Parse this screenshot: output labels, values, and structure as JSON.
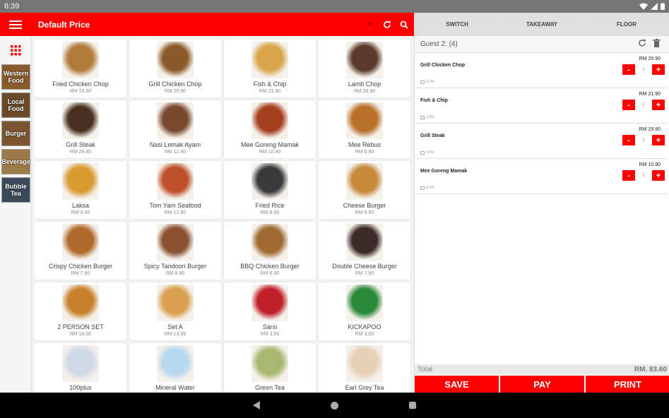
{
  "status": {
    "time": "6:39"
  },
  "toolbar": {
    "title": "Default Price"
  },
  "categories": [
    {
      "label": "Western Food",
      "color": "#8b5a2b"
    },
    {
      "label": "Local Food",
      "color": "#6b4a2a"
    },
    {
      "label": "Burger",
      "color": "#7a5530"
    },
    {
      "label": "Beverage",
      "color": "#9c7b48"
    },
    {
      "label": "Bubble Tea",
      "color": "#3a4a5a"
    }
  ],
  "products": [
    {
      "name": "Fried Chicken Chop",
      "price": "RM 19.90",
      "color": "#b07a3a"
    },
    {
      "name": "Grill Chicken Chop",
      "price": "RM 20.90",
      "color": "#8a5a2a"
    },
    {
      "name": "Fish & Chip",
      "price": "RM 21.90",
      "color": "#d9a54a"
    },
    {
      "name": "Lamb Chop",
      "price": "RM 26.90",
      "color": "#5a3a2a"
    },
    {
      "name": "Grill Steak",
      "price": "RM 29.90",
      "color": "#4a3020"
    },
    {
      "name": "Nasi Lemak Ayam",
      "price": "RM 12.90",
      "color": "#7a4a30"
    },
    {
      "name": "Mee Goreng Mamak",
      "price": "RM 10.90",
      "color": "#a5401f"
    },
    {
      "name": "Mee Rebus",
      "price": "RM 6.90",
      "color": "#b8702a"
    },
    {
      "name": "Laksa",
      "price": "RM 9.90",
      "color": "#d99a30"
    },
    {
      "name": "Tom Yam Seafood",
      "price": "RM 12.90",
      "color": "#c0502a"
    },
    {
      "name": "Fried Rice",
      "price": "RM 8.90",
      "color": "#3a3a3a"
    },
    {
      "name": "Cheese Burger",
      "price": "RM 6.90",
      "color": "#c78a3a"
    },
    {
      "name": "Crispy Chicken Burger",
      "price": "RM 7.90",
      "color": "#b06a2a"
    },
    {
      "name": "Spicy Tandoori Burger",
      "price": "RM 8.90",
      "color": "#8a5030"
    },
    {
      "name": "BBQ Chicken Burger",
      "price": "RM 6.90",
      "color": "#a06a30"
    },
    {
      "name": "Double Cheese Burger",
      "price": "RM 7.90",
      "color": "#3a2a2a"
    },
    {
      "name": "2 PERSON SET",
      "price": "RM 18.00",
      "color": "#c8802a"
    },
    {
      "name": "Set A",
      "price": "RM 13.99",
      "color": "#d8a050"
    },
    {
      "name": "Sarsi",
      "price": "RM 3.00",
      "color": "#c0202a"
    },
    {
      "name": "KICKAPOO",
      "price": "RM 3.00",
      "color": "#2a8a3a"
    },
    {
      "name": "100plus",
      "price": "",
      "color": "#d0d8e8"
    },
    {
      "name": "Mineral Water",
      "price": "",
      "color": "#b8d8f0"
    },
    {
      "name": "Green Tea",
      "price": "",
      "color": "#a8b870"
    },
    {
      "name": "Earl Grey Tea",
      "price": "",
      "color": "#e8d0b8"
    }
  ],
  "tabs": {
    "switch": "SWITCH",
    "takeaway": "TAKEAWAY",
    "floor": "FLOOR"
  },
  "guest": {
    "label": "Guest 2: (4)"
  },
  "order": [
    {
      "name": "Grill Chicken Chop",
      "price": "RM 20.90",
      "qty": "1",
      "note": "note"
    },
    {
      "name": "Fish & Chip",
      "price": "RM 21.90",
      "qty": "1",
      "note": "note"
    },
    {
      "name": "Grill Steak",
      "price": "RM 29.90",
      "qty": "1",
      "note": "note"
    },
    {
      "name": "Mee Goreng Mamak",
      "price": "RM 10.90",
      "qty": "1",
      "note": "note"
    }
  ],
  "stepper": {
    "minus": "-",
    "plus": "+"
  },
  "total": {
    "label": "Total",
    "value": "RM. 83.60"
  },
  "actions": {
    "save": "SAVE",
    "pay": "PAY",
    "print": "PRINT"
  },
  "colors": {
    "accent": "#ff0000"
  }
}
